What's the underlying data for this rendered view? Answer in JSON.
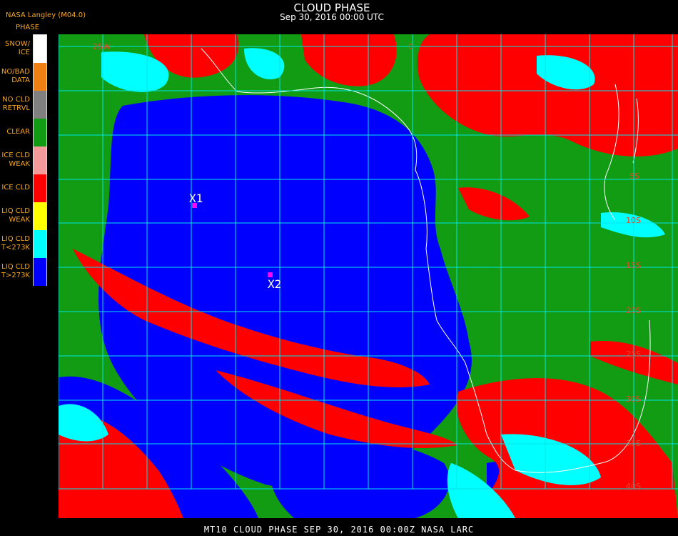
{
  "header": {
    "source": "NASA Langley (M04.0)",
    "title": "CLOUD PHASE",
    "date": "Sep 30, 2016 00:00 UTC"
  },
  "legend": {
    "title": "PHASE",
    "items": [
      {
        "label": "SNOW/\nICE",
        "color": "#ffffff"
      },
      {
        "label": "NO/BAD\nDATA",
        "color": "#f07f14"
      },
      {
        "label": "NO CLD\nRETRVL",
        "color": "#808080"
      },
      {
        "label": "CLEAR",
        "color": "#119c14"
      },
      {
        "label": "ICE CLD\nWEAK",
        "color": "#f49a9a"
      },
      {
        "label": "ICE CLD",
        "color": "#ff0000"
      },
      {
        "label": "LIQ CLD\nWEAK",
        "color": "#ffff00"
      },
      {
        "label": "LIQ CLD\nT<273K",
        "color": "#00ffff"
      },
      {
        "label": "LIQ CLD\nT>273K",
        "color": "#0000ff"
      }
    ]
  },
  "map": {
    "grid_labels": {
      "lon_top": [
        "25W",
        "0"
      ],
      "lat_right": [
        "5S",
        "10S",
        "15S",
        "20S",
        "25S",
        "30S",
        "35S",
        "40S"
      ]
    },
    "markers": [
      {
        "label": "X1",
        "color": "#ff00ff"
      },
      {
        "label": "X2",
        "color": "#ff00ff"
      }
    ]
  },
  "footer": {
    "text": "MT10   CLOUD PHASE   SEP 30, 2016 00:00Z   NASA LARC"
  }
}
